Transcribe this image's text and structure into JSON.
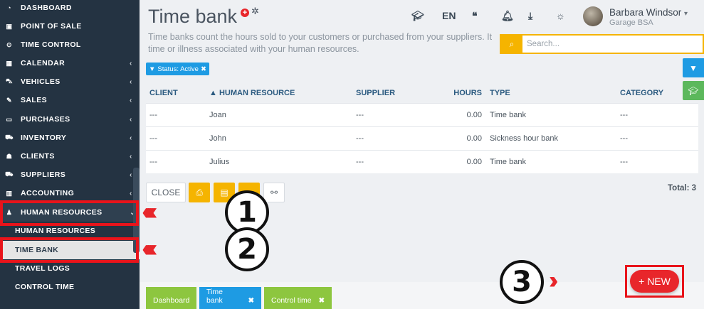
{
  "sidebar": {
    "items": [
      {
        "label": "DASHBOARD",
        "icon": "dashboard-icon",
        "chevron": false
      },
      {
        "label": "POINT OF SALE",
        "icon": "point-of-sale-icon",
        "chevron": false
      },
      {
        "label": "TIME CONTROL",
        "icon": "clock-icon",
        "chevron": false
      },
      {
        "label": "CALENDAR",
        "icon": "calendar-icon",
        "chevron": true
      },
      {
        "label": "VEHICLES",
        "icon": "car-icon",
        "chevron": true
      },
      {
        "label": "SALES",
        "icon": "edit-icon",
        "chevron": true
      },
      {
        "label": "PURCHASES",
        "icon": "credit-card-icon",
        "chevron": true
      },
      {
        "label": "INVENTORY",
        "icon": "truck-icon",
        "chevron": true
      },
      {
        "label": "CLIENTS",
        "icon": "users-icon",
        "chevron": true
      },
      {
        "label": "SUPPLIERS",
        "icon": "van-icon",
        "chevron": true
      },
      {
        "label": "ACCOUNTING",
        "icon": "bar-chart-icon",
        "chevron": true
      },
      {
        "label": "HUMAN RESOURCES",
        "icon": "user-icon",
        "chevron": true
      }
    ],
    "subitems": [
      {
        "label": "HUMAN RESOURCES"
      },
      {
        "label": "TIME BANK"
      },
      {
        "label": "TRAVEL LOGS"
      },
      {
        "label": "CONTROL TIME"
      }
    ]
  },
  "header": {
    "title": "Time bank",
    "description": "Time banks count the hours sold to your customers or purchased from your suppliers. It time or illness associated with your human resources.",
    "language": "EN",
    "user_name": "Barbara Windsor",
    "user_company": "Garage BSA"
  },
  "search": {
    "placeholder": "Search..."
  },
  "filter": {
    "label": "Status: Active"
  },
  "table": {
    "columns": {
      "client": "CLIENT",
      "human_resource": "HUMAN RESOURCE",
      "supplier": "SUPPLIER",
      "hours": "HOURS",
      "type": "TYPE",
      "category": "CATEGORY"
    },
    "rows": [
      {
        "client": "---",
        "human_resource": "Joan",
        "supplier": "---",
        "hours": "0.00",
        "type": "Time bank",
        "category": "---"
      },
      {
        "client": "---",
        "human_resource": "John",
        "supplier": "---",
        "hours": "0.00",
        "type": "Sickness hour bank",
        "category": "---"
      },
      {
        "client": "---",
        "human_resource": "Julius",
        "supplier": "---",
        "hours": "0.00",
        "type": "Time bank",
        "category": "---"
      }
    ]
  },
  "toolbar": {
    "close_label": "CLOSE",
    "total": "Total: 3"
  },
  "actions": {
    "new_label": "+ NEW"
  },
  "annotations": {
    "step1": "1",
    "step2": "2",
    "step3": "3",
    "arrow": "‹‹‹‹‹",
    "arrow_right": "››››"
  },
  "footer": {
    "tabs": [
      {
        "label": "Dashboard",
        "color": "#8dc63f"
      },
      {
        "label": "Time bank",
        "color": "#1e9be3"
      },
      {
        "label": "Control time",
        "color": "#8dc63f"
      }
    ]
  },
  "colors": {
    "accent_red": "#e8262b",
    "yellow": "#f5b400",
    "blue": "#1e9be3",
    "green": "#5cb85c",
    "sidebar": "#243342"
  }
}
